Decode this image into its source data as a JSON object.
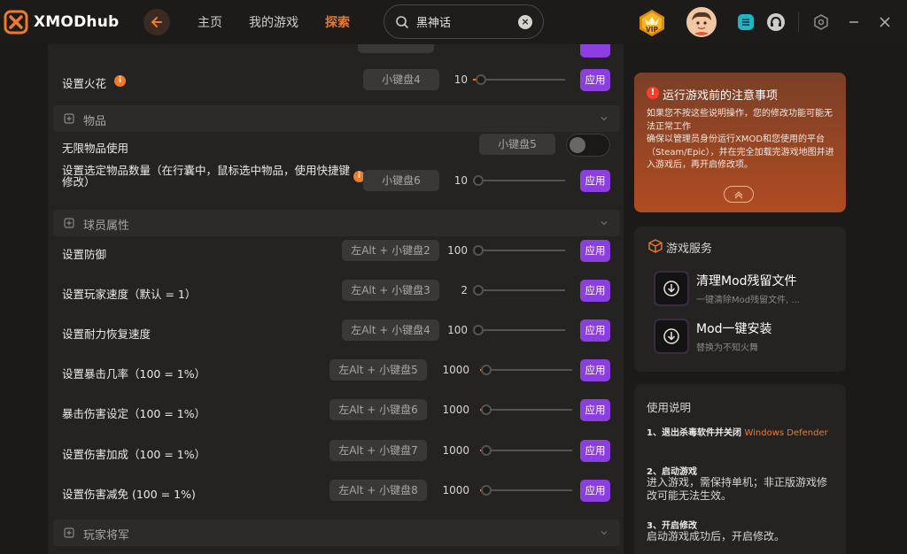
{
  "app": {
    "name": "XMODhub"
  },
  "nav": {
    "items": [
      {
        "label": "主页",
        "active": false
      },
      {
        "label": "我的游戏",
        "active": false
      },
      {
        "label": "探索",
        "active": true
      }
    ]
  },
  "search": {
    "value": "黑神话",
    "placeholder": ""
  },
  "vip": {
    "label": "VIP"
  },
  "colors": {
    "accent": "#f07a2b",
    "apply": "#8c3ee0",
    "notice": "#b04c22"
  },
  "mods": {
    "apply_label": "应用",
    "rows": [
      {
        "label": "设置火花",
        "info": true,
        "key": "小键盘4",
        "value": "10",
        "fraction": 0.05
      },
      {
        "section": "物品"
      },
      {
        "label": "无限物品使用",
        "info": false,
        "key": "小键盘5",
        "toggle": true,
        "toggle_on": false
      },
      {
        "label": "设置选定物品数量（在行囊中，鼠标选中物品，使用快捷键修改）",
        "info": true,
        "key": "小键盘6",
        "value": "10",
        "fraction": 0.0
      },
      {
        "section": "球员属性"
      },
      {
        "label": "设置防御",
        "info": false,
        "key": "左Alt + 小键盘2",
        "value": "100",
        "fraction": 0.0
      },
      {
        "label": "设置玩家速度（默认 = 1）",
        "info": false,
        "key": "左Alt + 小键盘3",
        "value": "2",
        "fraction": 0.0
      },
      {
        "label": "设置耐力恢复速度",
        "info": false,
        "key": "左Alt + 小键盘4",
        "value": "100",
        "fraction": 0.0
      },
      {
        "label": "设置暴击几率（100 = 1%）",
        "info": false,
        "key": "左Alt + 小键盘5",
        "value": "1000",
        "fraction": 0.03
      },
      {
        "label": "暴击伤害设定（100 = 1%）",
        "info": false,
        "key": "左Alt + 小键盘6",
        "value": "1000",
        "fraction": 0.03
      },
      {
        "label": "设置伤害加成（100 = 1%）",
        "info": false,
        "key": "左Alt + 小键盘7",
        "value": "1000",
        "fraction": 0.03
      },
      {
        "label": "设置伤害减免 (100 = 1%)",
        "info": false,
        "key": "左Alt + 小键盘8",
        "value": "1000",
        "fraction": 0.03
      },
      {
        "section": "玩家将军"
      }
    ]
  },
  "notice": {
    "title": "运行游戏前的注意事项",
    "body": "如果您不按这些说明操作，您的修改功能可能无法正常工作\n确保以管理员身份运行XMOD和您使用的平台（Steam/Epic），并在完全加载完游戏地图并进入游戏后，再开启修改项。"
  },
  "services": {
    "title": "游戏服务",
    "items": [
      {
        "name": "清理Mod残留文件",
        "desc": "一键清除Mod残留文件, ..."
      },
      {
        "name": "Mod一键安装",
        "desc": "替换为不知火舞"
      }
    ]
  },
  "usage": {
    "title": "使用说明",
    "steps": [
      {
        "title": "1、退出杀毒软件并关闭",
        "title_highlight": "Windows Defender",
        "body": ""
      },
      {
        "title": "2、启动游戏",
        "body": "进入游戏，需保持单机；非正版游戏修改可能无法生效。"
      },
      {
        "title": "3、开启修改",
        "body": "启动游戏成功后，开启修改。"
      }
    ]
  }
}
